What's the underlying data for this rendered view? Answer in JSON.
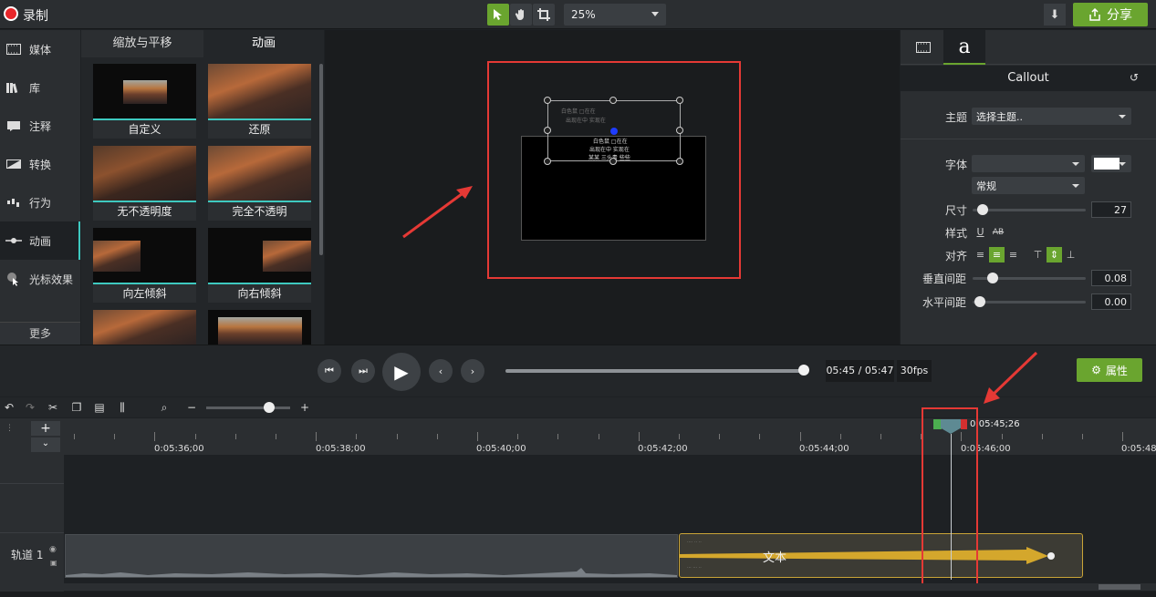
{
  "toolbar": {
    "record_label": "录制",
    "zoom_value": "25%",
    "share_label": "分享"
  },
  "sidebar": {
    "items": [
      {
        "label": "媒体",
        "icon": "film-icon"
      },
      {
        "label": "库",
        "icon": "library-icon"
      },
      {
        "label": "注释",
        "icon": "annotation-icon"
      },
      {
        "label": "转换",
        "icon": "transition-icon"
      },
      {
        "label": "行为",
        "icon": "behavior-icon"
      },
      {
        "label": "动画",
        "icon": "animation-icon"
      },
      {
        "label": "光标效果",
        "icon": "cursor-icon"
      }
    ],
    "more_label": "更多",
    "active_index": 5
  },
  "anim_panel": {
    "tabs": [
      "缩放与平移",
      "动画"
    ],
    "active_tab": 1,
    "thumbnails": [
      "自定义",
      "还原",
      "无不透明度",
      "完全不透明",
      "向左倾斜",
      "向右倾斜"
    ]
  },
  "canvas": {
    "callout_lines": [
      "白色鼠 □在在",
      "出现在中 实现在",
      "某某 三头青 些些"
    ]
  },
  "properties": {
    "tabs": [
      "media",
      "a"
    ],
    "header": "Callout",
    "theme_label": "主题",
    "theme_value": "选择主题..",
    "font_label": "字体",
    "font_value": "",
    "font_style_value": "常规",
    "size_label": "尺寸",
    "size_value": "27",
    "style_label": "样式",
    "style_underline": "U",
    "style_strike": "AB",
    "align_label": "对齐",
    "line_spacing_label": "垂直间距",
    "line_spacing_value": "0.08",
    "char_spacing_label": "水平间距",
    "char_spacing_value": "0.00",
    "font_color": "#ffffff"
  },
  "playback": {
    "time": "05:45 / 05:47",
    "fps": "30fps",
    "properties_label": "属性",
    "progress": 0.994
  },
  "timeline": {
    "ticks": [
      "0:05:36;00",
      "0:05:38;00",
      "0:05:40;00",
      "0:05:42;00",
      "0:05:44;00",
      "0:05:46;00",
      "0:05:48;"
    ],
    "playhead_time": "0:05:45;26",
    "track_label": "轨道 1",
    "text_clip_label": "文本"
  },
  "colors": {
    "accent": "#6aa52f",
    "highlight": "#e53935",
    "teal": "#3ec9c0"
  }
}
